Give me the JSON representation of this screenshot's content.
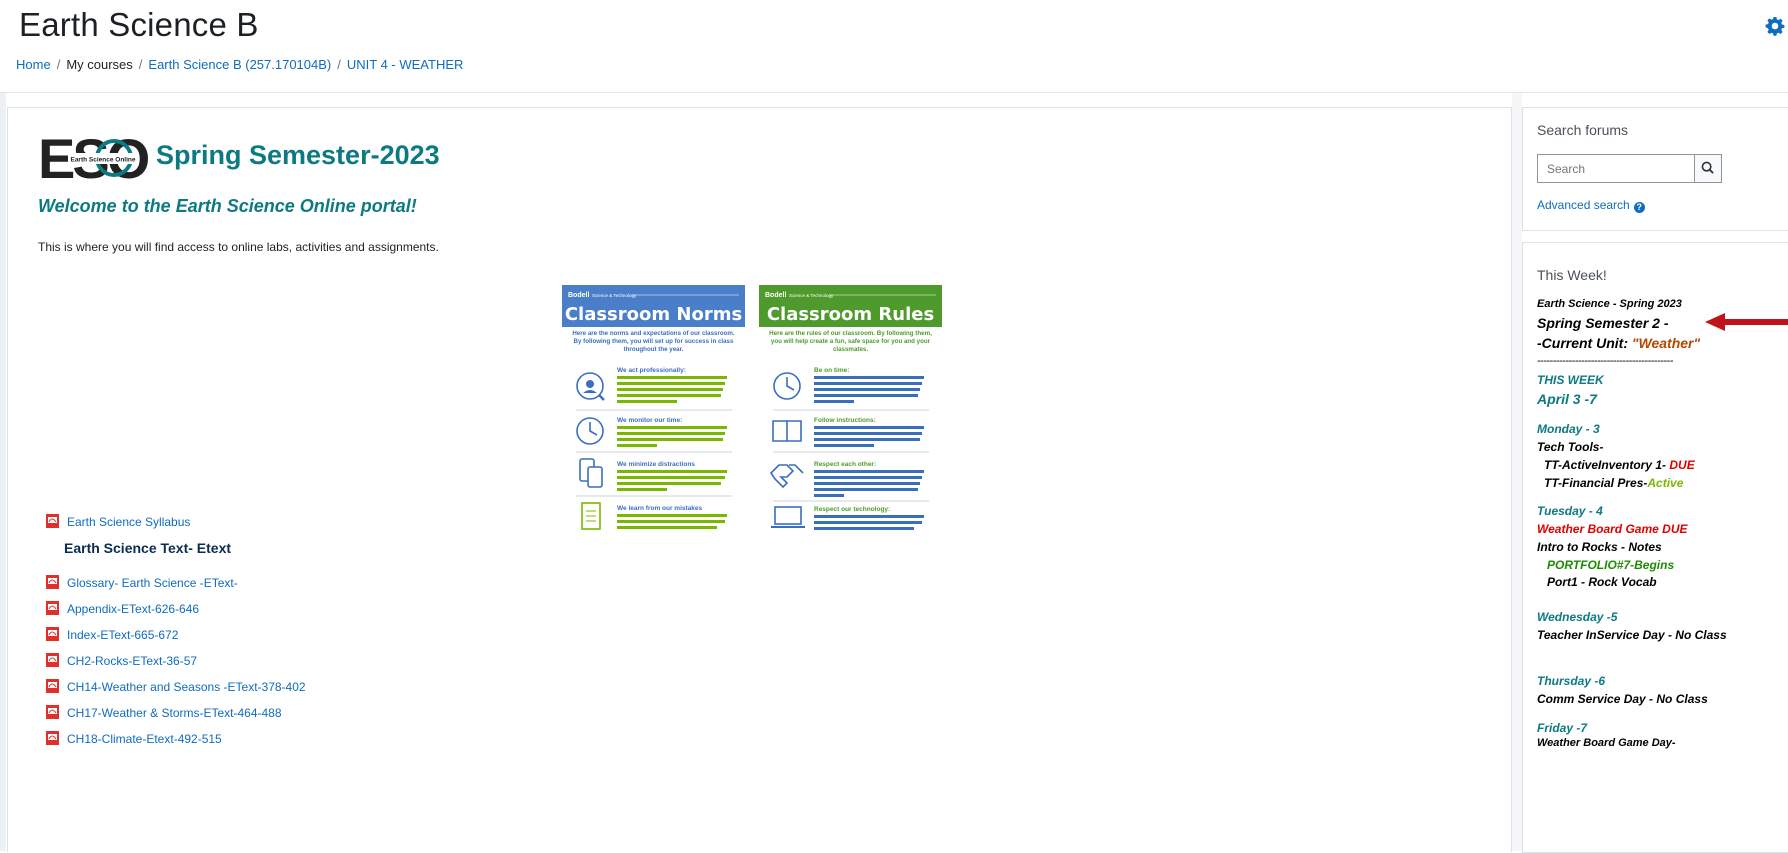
{
  "header": {
    "title": "Earth Science B",
    "breadcrumb": [
      "Home",
      "My courses",
      "Earth Science B (257.170104B)",
      "UNIT 4 - WEATHER"
    ]
  },
  "main": {
    "logo_text": "ESO",
    "logo_subtext": "Earth Science Online",
    "semester_title": "Spring Semester-2023",
    "welcome": "Welcome to the Earth Science Online portal!",
    "intro": "This is where you will find access to online labs, activities and assignments.",
    "posters": [
      {
        "brand": "Bodell",
        "brand_sub": "Science & Technology",
        "title": "Classroom Norms",
        "header_color": "#4a7ec9",
        "accent_color": "#3a6fbf",
        "text_color": "#7ab800",
        "intro": "Here are the norms and expectations of our classroom. By following them, you will set up for success in class throughout the year.",
        "items": [
          {
            "icon": "person-magnifier-icon",
            "heading": "We act professionally:"
          },
          {
            "icon": "clock-icon",
            "heading": "We monitor our time:"
          },
          {
            "icon": "devices-icon",
            "heading": "We minimize distractions"
          },
          {
            "icon": "clipboard-icon",
            "heading": "We learn from our mistakes"
          }
        ]
      },
      {
        "brand": "Bodell",
        "brand_sub": "Science & Technology",
        "title": "Classroom Rules",
        "header_color": "#4f9a2c",
        "accent_color": "#3a6fbf",
        "text_color": "#3a6fbf",
        "intro": "Here are the rules of our classroom. By following them, you will help create a fun, safe space for you and your classmates.",
        "items": [
          {
            "icon": "clock-icon",
            "heading": "Be on time:"
          },
          {
            "icon": "book-icon",
            "heading": "Follow instructions:"
          },
          {
            "icon": "handshake-icon",
            "heading": "Respect each other:"
          },
          {
            "icon": "laptop-icon",
            "heading": "Respect our technology:"
          }
        ]
      }
    ],
    "files_top": [
      "Earth Science Syllabus"
    ],
    "etext_heading": "Earth Science Text- Etext",
    "files": [
      "Glossary- Earth Science -EText-",
      "Appendix-EText-626-646",
      "Index-EText-665-672",
      "CH2-Rocks-EText-36-57",
      "CH14-Weather and Seasons -EText-378-402",
      "CH17-Weather & Storms-EText-464-488",
      "CH18-Climate-Etext-492-515"
    ]
  },
  "search_block": {
    "title": "Search forums",
    "placeholder": "Search",
    "advanced": "Advanced search"
  },
  "week_block": {
    "title": "This Week!",
    "course": "Earth Science - Spring 2023",
    "semester": "Spring Semester 2 -",
    "unit_prefix": "-Current Unit: ",
    "unit_name": "\"Weather\"",
    "divider": "-------------------------------------------",
    "this_week": "THIS WEEK",
    "dates": "April 3 -7",
    "monday": "Monday - 3",
    "monday_1": "Tech Tools-",
    "monday_2": "TT-ActiveInventory 1- ",
    "monday_2_status": "DUE",
    "monday_3": "TT-Financial Pres-",
    "monday_3_status": "Active",
    "tuesday": "Tuesday  - 4",
    "tuesday_1": "Weather Board Game DUE",
    "tuesday_2": "Intro to Rocks - Notes",
    "tuesday_3": "PORTFOLIO#7-Begins",
    "tuesday_4": "Port1 - Rock Vocab",
    "wednesday": "Wednesday -5",
    "wednesday_1": "Teacher InService Day - No Class",
    "thursday": "Thursday -6",
    "thursday_1": "Comm Service Day - No Class",
    "friday": "Friday -7",
    "friday_1": "Weather Board Game Day-"
  }
}
